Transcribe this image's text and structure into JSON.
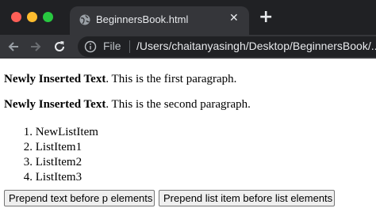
{
  "browser": {
    "tab_title": "BeginnersBook.html",
    "tab_close": "✕",
    "new_tab": "+",
    "address": {
      "scheme_label": "File",
      "url": "/Users/chaitanyasingh/Desktop/BeginnersBook/..."
    },
    "icons": {
      "tab_favicon": "globe-icon",
      "back": "back-arrow-icon",
      "forward": "forward-arrow-icon",
      "reload": "reload-icon",
      "info": "info-icon"
    }
  },
  "page": {
    "paragraphs": [
      {
        "bold": "Newly Inserted Text",
        "rest": ". This is the first paragraph."
      },
      {
        "bold": "Newly Inserted Text",
        "rest": ". This is the second paragraph."
      }
    ],
    "list": [
      {
        "num": "1.",
        "text": "NewListItem"
      },
      {
        "num": "2.",
        "text": "ListItem1"
      },
      {
        "num": "3.",
        "text": "ListItem2"
      },
      {
        "num": "4.",
        "text": "ListItem3"
      }
    ],
    "buttons": {
      "prepend_text": "Prepend text before p elements",
      "prepend_list": "Prepend list item before list elements"
    }
  }
}
